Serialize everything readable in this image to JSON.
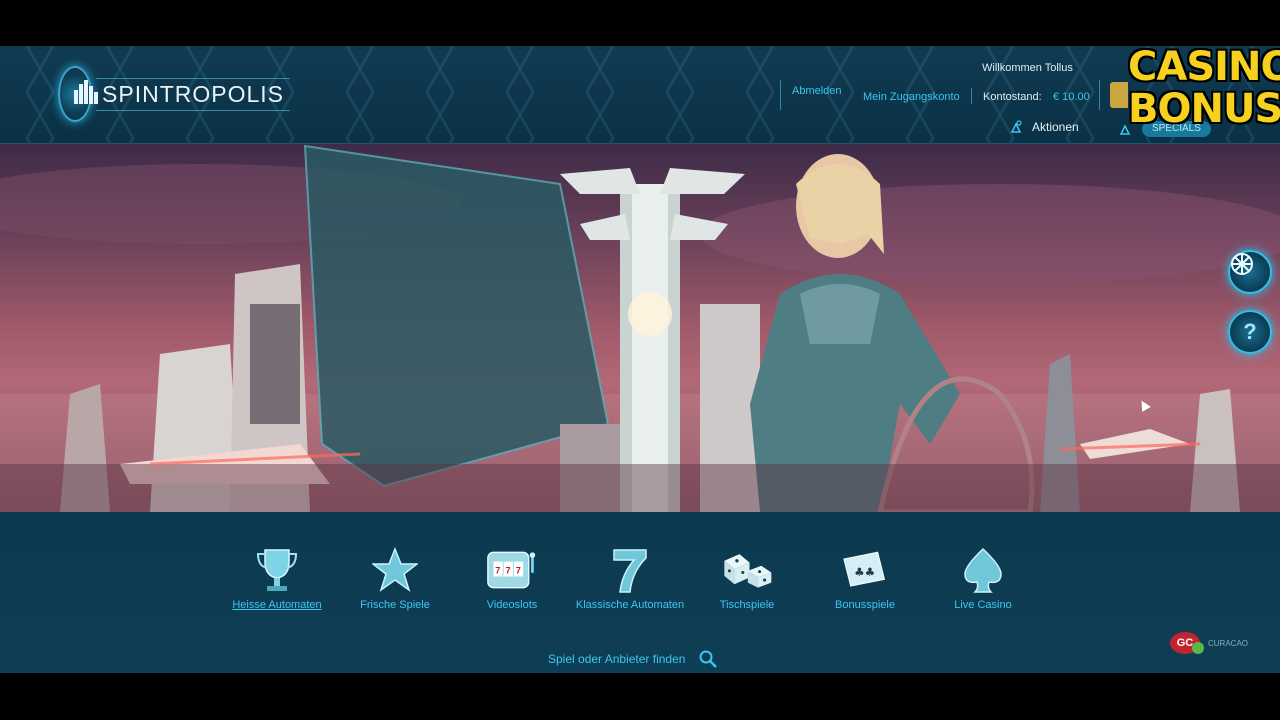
{
  "brand": {
    "name": "SPINTROPOLIS"
  },
  "header": {
    "welcome": "Willkommen Tollus",
    "logout": "Abmelden",
    "my_account": "Mein Zugangskonto",
    "balance_label": "Kontostand:",
    "balance_value": "€ 10.00",
    "promotions": "Aktionen",
    "specials": "SPECIALS"
  },
  "categories": [
    {
      "label": "Heisse Automaten",
      "icon": "trophy-icon",
      "active": true
    },
    {
      "label": "Frische Spiele",
      "icon": "star-icon",
      "active": false
    },
    {
      "label": "Videoslots",
      "icon": "slot-machine-icon",
      "active": false
    },
    {
      "label": "Klassische Automaten",
      "icon": "seven-icon",
      "active": false
    },
    {
      "label": "Tischspiele",
      "icon": "dice-icon",
      "active": false
    },
    {
      "label": "Bonusspiele",
      "icon": "cards-icon",
      "active": false
    },
    {
      "label": "Live Casino",
      "icon": "spade-icon",
      "active": false
    }
  ],
  "search": {
    "placeholder": "Spiel oder Anbieter finden"
  },
  "license": {
    "badge": "GC",
    "text": "CURACAO"
  },
  "side_buttons": {
    "help": "?"
  },
  "watermark": {
    "line1": "CASINO+",
    "line2": "BONUS"
  },
  "colors": {
    "accent": "#3cc7ee",
    "header_bg": "#0f3b52",
    "gold": "#caa540"
  }
}
